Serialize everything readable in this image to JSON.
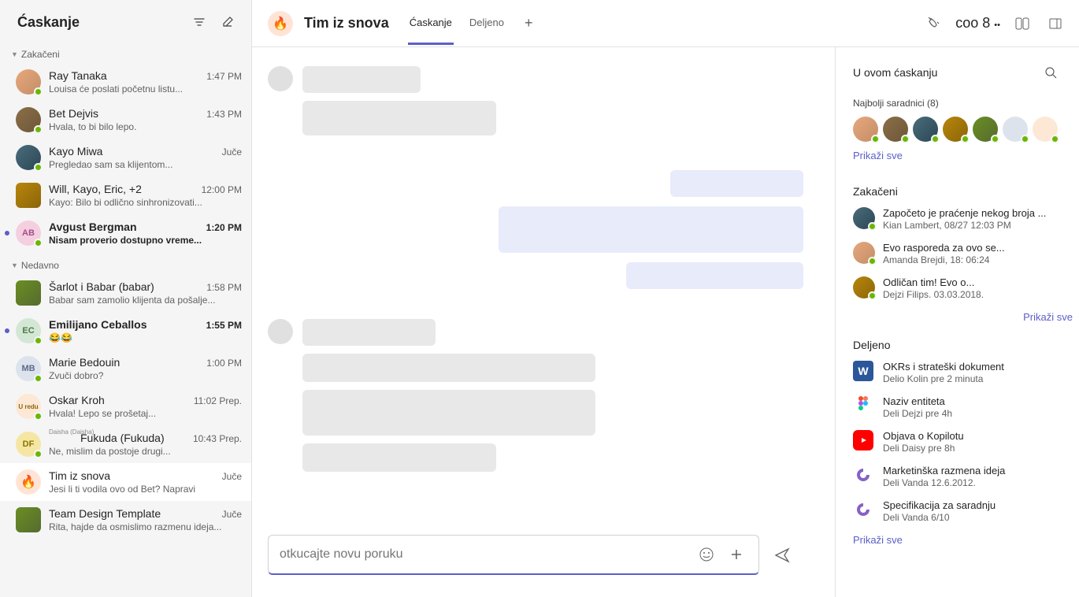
{
  "sidebar": {
    "title": "Ćaskanje",
    "pinned_label": "Zakačeni",
    "recent_label": "Nedavno",
    "pinned": [
      {
        "name": "Ray Tanaka",
        "preview": "Louisa će poslati početnu listu...",
        "time": "1:47 PM",
        "unread": false,
        "avatar": "c1"
      },
      {
        "name": "Bet      Dejvis",
        "preview": "Hvala, to bi bilo lepo.",
        "time": "1:43 PM",
        "unread": false,
        "avatar": "c2"
      },
      {
        "name": "Kayo Miwa",
        "preview": "Pregledao sam sa klijentom...",
        "time": "Juče",
        "unread": false,
        "avatar": "c3"
      },
      {
        "name": "Will, Kayo, Eric, +2",
        "preview": "Kayo: Bilo bi odlično sinhronizovati...",
        "time": "12:00 PM",
        "unread": false,
        "avatar": "group"
      },
      {
        "name": "Avgust Bergman",
        "preview": "Nisam proverio dostupno vreme...",
        "time": "1:20 PM",
        "unread": true,
        "avatar": "c5",
        "initials": "AB"
      }
    ],
    "recent": [
      {
        "name": "Šarlot i         Babar (babar)",
        "preview": "Babar sam zamolio klijenta da pošalje...",
        "time": "1:58 PM",
        "unread": false,
        "avatar": "group2"
      },
      {
        "name": "Emilijano Ceballos",
        "preview": "😂😂",
        "time": "1:55 PM",
        "unread": true,
        "avatar": "c7",
        "initials": "EC"
      },
      {
        "name": "Marie Bedouin",
        "preview": "Zvuči dobro?",
        "time": "1:00 PM",
        "unread": false,
        "avatar": "c8",
        "initials": "MB"
      },
      {
        "name": "Oskar Kroh",
        "preview": "Hvala! Lepo se prošetaj...",
        "time": "11:02 Prep.",
        "unread": false,
        "avatar": "c9",
        "initials": "U redu"
      },
      {
        "name": "Fukuda (Fukuda)",
        "preview": "Ne, mislim da postoje drugi...",
        "time": "10:43 Prep.",
        "unread": false,
        "avatar": "c10",
        "initials": "DF",
        "extra": "Daisha (Daisha)"
      },
      {
        "name": "Tim iz snova",
        "preview": "Jesi li ti vodila ovo od Bet? Napravi",
        "time": "Juče",
        "unread": false,
        "avatar": "fire",
        "active": true
      },
      {
        "name": "Team Design Template",
        "preview": "Rita, hajde da osmislimo razmenu ideja...",
        "time": "Juče",
        "unread": false,
        "avatar": "group3"
      }
    ]
  },
  "header": {
    "title": "Tim iz snova",
    "tabs": [
      "Ćaskanje",
      "Deljeno"
    ],
    "participants": "coo 8"
  },
  "compose": {
    "placeholder": "otkucajte novu poruku"
  },
  "rpanel": {
    "title": "U ovom ćaskanju",
    "contributors_label": "Najbolji saradnici (8)",
    "show_all": "Prikaži sve",
    "pinned_label": "Zakačeni",
    "pinned": [
      {
        "t1": "Započeto je praćenje nekog broja ...",
        "t2": "Kian Lambert, 08/27 12:03 PM"
      },
      {
        "t1": "Evo rasporeda za ovo se...",
        "t2": "Amanda Brejdi, 18: 06:24"
      },
      {
        "t1": "Odličan tim!           Evo o...",
        "t2": "Dejzi Filips. 03.03.2018."
      }
    ],
    "shared_label": "Deljeno",
    "shared": [
      {
        "icon": "word",
        "t1": "OKRs i strateški dokument",
        "t2": "Delio Kolin pre 2 minuta"
      },
      {
        "icon": "figma",
        "t1": "Naziv entiteta",
        "t2": "Deli Dejzi pre 4h"
      },
      {
        "icon": "youtube",
        "t1": "Objava o Kopilotu",
        "t2": "Deli Daisy pre 8h"
      },
      {
        "icon": "loop",
        "t1": "Marketinška razmena ideja",
        "t2": "Deli Vanda 12.6.2012."
      },
      {
        "icon": "loop",
        "t1": "Specifikacija za saradnju",
        "t2": "Deli Vanda 6/10"
      }
    ]
  }
}
